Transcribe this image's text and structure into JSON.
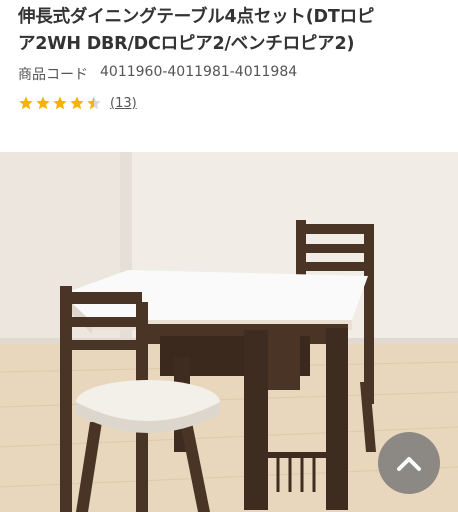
{
  "product": {
    "title_line1": "伸長式ダイニングテーブル4点セット(DTロピ",
    "title_line2": "ア2WH DBR/DCロピア2/ベンチロピア2)",
    "code_label": "商品コード",
    "code_value": "4011960-4011981-4011984"
  },
  "rating": {
    "value": 4.5,
    "max": 5,
    "review_count": "(13)",
    "star_color": "#f5b400"
  },
  "image": {
    "icon": "product-photo"
  },
  "scroll_top": {
    "icon": "chevron-up-icon"
  }
}
